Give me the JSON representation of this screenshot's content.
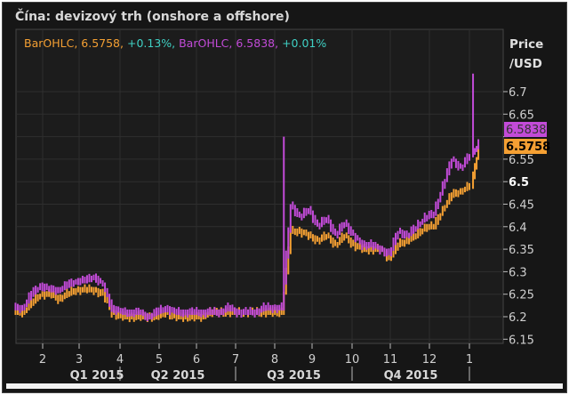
{
  "title": "Čína: devizový trh (onshore a offshore)",
  "legend": {
    "s1_name": "BarOHLC",
    "s1_value": "6.5758",
    "s1_change": "+0.13%",
    "s2_name": "BarOHLC",
    "s2_value": "6.5838",
    "s2_change": "+0.01%"
  },
  "axis_unit": [
    "Price",
    "/USD"
  ],
  "colors": {
    "onshore": "#f5a033",
    "offshore": "#c24bd8",
    "change": "#3fd0c4",
    "background": "#161616",
    "grid": "#2e2e2e"
  },
  "chart_data": {
    "type": "line",
    "style": "OHLC bars",
    "x": [
      "2015-01-16",
      "2015-01-23",
      "2015-01-30",
      "2015-02-06",
      "2015-02-13",
      "2015-02-20",
      "2015-02-27",
      "2015-03-06",
      "2015-03-13",
      "2015-03-20",
      "2015-03-27",
      "2015-04-03",
      "2015-04-10",
      "2015-04-17",
      "2015-04-24",
      "2015-05-01",
      "2015-05-08",
      "2015-05-15",
      "2015-05-22",
      "2015-05-29",
      "2015-06-05",
      "2015-06-12",
      "2015-06-19",
      "2015-06-26",
      "2015-07-03",
      "2015-07-10",
      "2015-07-17",
      "2015-07-24",
      "2015-07-31",
      "2015-08-07",
      "2015-08-14",
      "2015-08-21",
      "2015-08-28",
      "2015-09-04",
      "2015-09-11",
      "2015-09-18",
      "2015-09-25",
      "2015-10-02",
      "2015-10-09",
      "2015-10-16",
      "2015-10-23",
      "2015-10-30",
      "2015-11-06",
      "2015-11-13",
      "2015-11-20",
      "2015-11-27",
      "2015-12-04",
      "2015-12-11",
      "2015-12-18",
      "2015-12-25",
      "2016-01-01",
      "2016-01-08"
    ],
    "series": [
      {
        "color": "#f5a033",
        "last_label": "6.5758",
        "values": [
          6.21,
          6.23,
          6.25,
          6.25,
          6.24,
          6.25,
          6.26,
          6.26,
          6.26,
          6.25,
          6.21,
          6.2,
          6.2,
          6.2,
          6.2,
          6.2,
          6.21,
          6.2,
          6.2,
          6.2,
          6.2,
          6.21,
          6.21,
          6.21,
          6.21,
          6.21,
          6.21,
          6.21,
          6.21,
          6.21,
          6.39,
          6.39,
          6.38,
          6.37,
          6.38,
          6.36,
          6.38,
          6.36,
          6.35,
          6.35,
          6.35,
          6.33,
          6.36,
          6.37,
          6.38,
          6.4,
          6.4,
          6.44,
          6.47,
          6.48,
          6.49,
          6.5758
        ],
        "highs": {}
      },
      {
        "color": "#c24bd8",
        "last_label": "6.5838",
        "values": [
          6.22,
          6.25,
          6.27,
          6.26,
          6.26,
          6.27,
          6.28,
          6.28,
          6.29,
          6.27,
          6.22,
          6.21,
          6.21,
          6.21,
          6.2,
          6.21,
          6.22,
          6.21,
          6.21,
          6.21,
          6.21,
          6.21,
          6.21,
          6.22,
          6.21,
          6.21,
          6.21,
          6.22,
          6.22,
          6.22,
          6.45,
          6.42,
          6.44,
          6.4,
          6.42,
          6.38,
          6.41,
          6.38,
          6.36,
          6.36,
          6.35,
          6.34,
          6.39,
          6.38,
          6.4,
          6.42,
          6.43,
          6.49,
          6.55,
          6.53,
          6.56,
          6.5838
        ],
        "highs": {
          "2015-08-14": 6.6,
          "2016-01-08": 6.74
        }
      }
    ],
    "yticks": [
      "6.15",
      "6.2",
      "6.25",
      "6.3",
      "6.35",
      "6.4",
      "6.45",
      "6.5",
      "6.55",
      "6.6",
      "6.65",
      "6.7"
    ],
    "ylim": [
      6.14,
      6.76
    ],
    "xticks": [
      "2",
      "3",
      "4",
      "5",
      "6",
      "7",
      "8",
      "9",
      "10",
      "11",
      "12",
      "1"
    ],
    "quarters": [
      "Q1 2015",
      "Q2 2015",
      "Q3 2015",
      "Q4 2015"
    ],
    "grid": true
  }
}
